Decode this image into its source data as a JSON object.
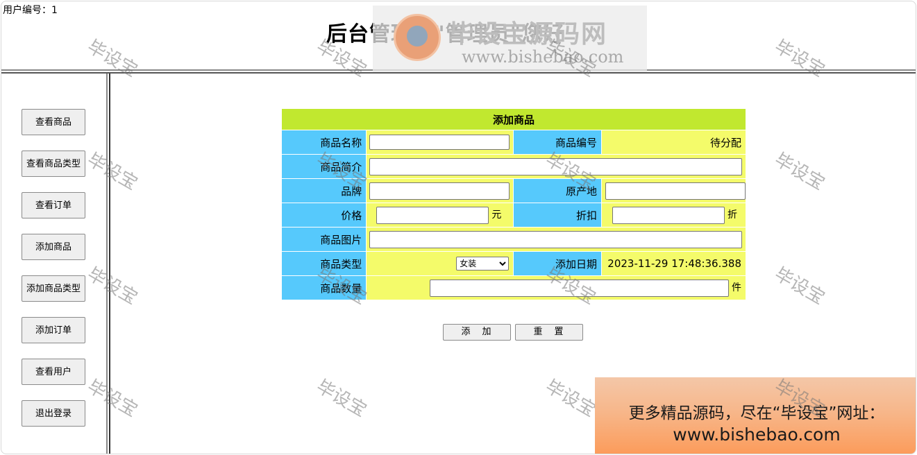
{
  "header": {
    "user_id_text": "用户编号：1",
    "title": "后台管理员\"管理员\"您好"
  },
  "sidebar": {
    "items": [
      {
        "label": "查看商品"
      },
      {
        "label": "查看商品类型"
      },
      {
        "label": "查看订单"
      },
      {
        "label": "添加商品"
      },
      {
        "label": "添加商品类型"
      },
      {
        "label": "添加订单"
      },
      {
        "label": "查看用户"
      },
      {
        "label": "退出登录"
      }
    ]
  },
  "form": {
    "title": "添加商品",
    "labels": {
      "name": "商品名称",
      "code": "商品编号",
      "intro": "商品简介",
      "brand": "品牌",
      "origin": "原产地",
      "price": "价格",
      "discount": "折扣",
      "image": "商品图片",
      "type": "商品类型",
      "date": "添加日期",
      "quantity": "商品数量"
    },
    "values": {
      "name": "",
      "code": "待分配",
      "intro": "",
      "brand": "",
      "origin": "",
      "price": "",
      "discount": "",
      "image": "",
      "type_selected": "女装",
      "date": "2023-11-29 17:48:36.388",
      "quantity": ""
    },
    "units": {
      "price": "元",
      "discount": "折",
      "quantity": "件"
    },
    "buttons": {
      "add": "添　加",
      "reset": "重　置"
    }
  },
  "watermark": {
    "text": "毕设宝",
    "logo_title": "毕设宝源码网",
    "logo_url": "www.bishebao.com"
  },
  "promo": {
    "line1": "更多精品源码，尽在“毕设宝”网址：",
    "line2": "www.bishebao.com"
  }
}
